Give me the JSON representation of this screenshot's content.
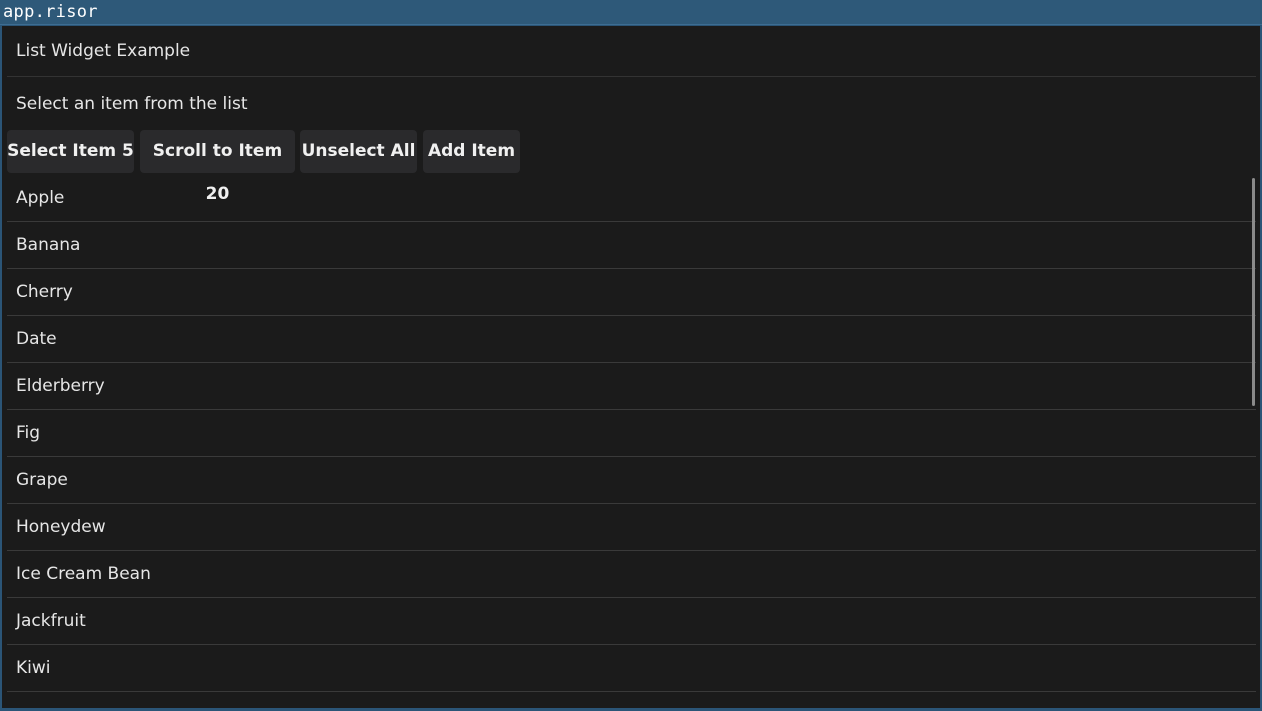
{
  "window": {
    "title": "app.risor"
  },
  "header": {
    "title": "List Widget Example"
  },
  "status": {
    "text": "Select an item from the list"
  },
  "toolbar": {
    "select_item_5": "Select Item 5",
    "scroll_to_item_20": "Scroll to Item 20",
    "unselect_all": "Unselect All",
    "add_item": "Add Item"
  },
  "list": {
    "items": [
      "Apple",
      "Banana",
      "Cherry",
      "Date",
      "Elderberry",
      "Fig",
      "Grape",
      "Honeydew",
      "Ice Cream Bean",
      "Jackfruit",
      "Kiwi"
    ]
  },
  "colors": {
    "background": "#1b1b1b",
    "titlebar": "#2e5979",
    "button": "#2a2a2c",
    "text": "#e6e6e6"
  }
}
